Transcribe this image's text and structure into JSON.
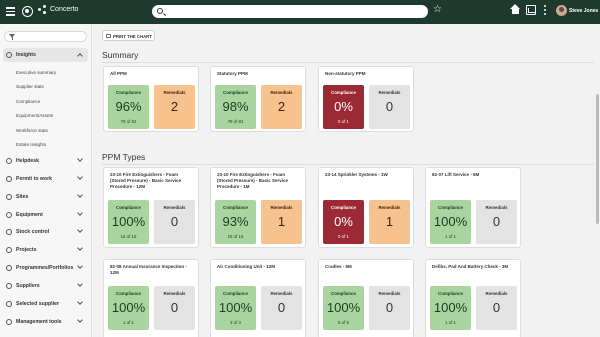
{
  "app": {
    "name": "Concerto",
    "user": "Steve Jones"
  },
  "icons": [
    "hamburger-icon",
    "gear-icon",
    "concerto-logo-icon",
    "search-icon",
    "star-icon",
    "home-icon",
    "chart-icon",
    "kebab-icon",
    "filter-icon",
    "printer-icon",
    "chevron-down-icon",
    "chevron-up-icon"
  ],
  "sidebar": {
    "active": "Insights",
    "insights_sub": [
      "Executive summary",
      "Supplier stats",
      "Compliance",
      "Equipment/Assets",
      "Workforce stats",
      "Estate Insights"
    ],
    "items": [
      "Helpdesk",
      "Permit to work",
      "Sites",
      "Equipment",
      "Stock control",
      "Projects",
      "Programmes/Portfolios",
      "Suppliers",
      "Selected supplier",
      "Management tools"
    ]
  },
  "print_button": "PRINT THE CHART",
  "summary": {
    "title": "Summary",
    "cards": [
      {
        "title": "All PPM",
        "compliance_label": "Compliance",
        "compliance": "96%",
        "ratio": "79 of 82",
        "remedials_label": "Remedials",
        "remedials": "2",
        "compliance_color": "#a9d4a0",
        "remedials_color": "#f8c28f"
      },
      {
        "title": "Statutory PPM",
        "compliance_label": "Compliance",
        "compliance": "98%",
        "ratio": "79 of 81",
        "remedials_label": "Remedials",
        "remedials": "2",
        "compliance_color": "#a9d4a0",
        "remedials_color": "#f8c28f"
      },
      {
        "title": "Non-statutory PPM",
        "compliance_label": "Compliance",
        "compliance": "0%",
        "ratio": "0 of 1",
        "remedials_label": "Remedials",
        "remedials": "0",
        "compliance_color": "#9b2a35",
        "remedials_color": "#e3e3e3"
      }
    ]
  },
  "ppm": {
    "title": "PPM Types",
    "cards": [
      {
        "title": "23-10 Fire Extinguishers - Foam (Stored Pressure) - Basic Service Procedure - 12M",
        "compliance_label": "Compliance",
        "compliance": "100%",
        "ratio": "16 of 16",
        "remedials_label": "Remedials",
        "remedials": "0"
      },
      {
        "title": "23-10 Fire Extinguishers - Foam (Stored Pressure) - Basic Service Procedure - 1M",
        "compliance_label": "Compliance",
        "compliance": "93%",
        "ratio": "15 of 16",
        "remedials_label": "Remedials",
        "remedials": "1"
      },
      {
        "title": "23-14 Sprinkler Systems - 1W",
        "compliance_label": "Compliance",
        "compliance": "0%",
        "ratio": "0 of 1",
        "remedials_label": "Remedials",
        "remedials": "1"
      },
      {
        "title": "82-07 Lift Service - 6M",
        "compliance_label": "Compliance",
        "compliance": "100%",
        "ratio": "1 of 1",
        "remedials_label": "Remedials",
        "remedials": "0"
      },
      {
        "title": "82-08 Annual Insurance Inspection - 12M",
        "compliance_label": "Compliance",
        "compliance": "100%",
        "ratio": "1 of 1",
        "remedials_label": "Remedials",
        "remedials": "0"
      },
      {
        "title": "Air Conditioning Unit - 12M",
        "compliance_label": "Compliance",
        "compliance": "100%",
        "ratio": "3 of 3",
        "remedials_label": "Remedials",
        "remedials": "0"
      },
      {
        "title": "Cradles - 6M",
        "compliance_label": "Compliance",
        "compliance": "100%",
        "ratio": "5 of 5",
        "remedials_label": "Remedials",
        "remedials": "0"
      },
      {
        "title": "Defibs, Pad And Battery Check - 3M",
        "compliance_label": "Compliance",
        "compliance": "100%",
        "ratio": "1 of 1",
        "remedials_label": "Remedials",
        "remedials": "0"
      }
    ]
  }
}
